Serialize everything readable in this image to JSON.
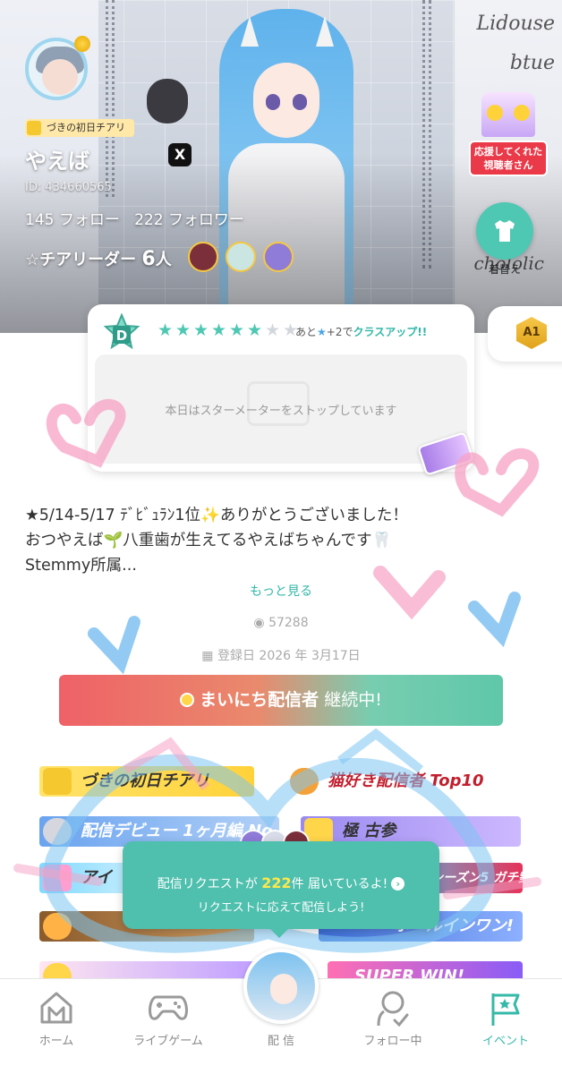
{
  "profile": {
    "cheer_tag": "づきの初日チアリ",
    "username": "やえば",
    "user_id": "ID: 434660565",
    "following_count": "145",
    "following_label": "フォロー",
    "follower_count": "222",
    "follower_label": "フォロワー",
    "cheerleader_label": "☆チアリーダー",
    "cheerleader_count": "6",
    "cheerleader_unit": "人",
    "cheer_more": "•••",
    "x_label": "X",
    "supporters_label": "応援してくれた\n視聴者さん",
    "dress_label": "着替え",
    "deco_text_1": "Lidouse",
    "deco_text_2": "btue",
    "deco_text_3": "chololic"
  },
  "star_meter": {
    "class_letter": "D",
    "stars_filled": 6,
    "stars_total": 8,
    "info_prefix": "あと",
    "info_plus": "+2で",
    "info_action": "クラスアップ!!",
    "message": "本日はスターメーターをストップしています",
    "tab_rank": "A1"
  },
  "bio": {
    "line1": "★5/14-5/17 ﾃﾞﾋﾞｭﾗﾝ1位✨ありがとうございました！",
    "line2": "おつやえば🌱八重歯が生えてるやえばちゃんです🦷",
    "line3": "Stemmy所属...",
    "more_label": "もっと見る",
    "views": "57288",
    "registered": "登録日 2026 年 3月17日"
  },
  "streak": {
    "label_bold": "まいにち配信者",
    "label_rest": " 継続中!"
  },
  "badges": [
    {
      "text": "づきの初日チアリ",
      "color": "#ffd84d"
    },
    {
      "text": "猫好き配信者 Top10",
      "color": "#ffffff"
    },
    {
      "text": "配信デビュー 1ヶ月編 No.1",
      "color": "#7fb2f0"
    },
    {
      "text": "極 古参",
      "color": "#b7a4f5"
    },
    {
      "text": "アイ",
      "color": "#9ee6ff"
    },
    {
      "text": "ットリ! シーズン5 ガチ勢",
      "color": "#5ed0f2"
    },
    {
      "text": "ホールインワン!",
      "color": "#5c86e0"
    },
    {
      "text": "SUPER WIN!",
      "color": "#ff6fb3"
    }
  ],
  "request_popup": {
    "prefix": "配信リクエストが",
    "count": "222",
    "unit": "件",
    "suffix": "届いているよ!",
    "line2": "リクエストに応えて配信しよう!"
  },
  "nav": {
    "home": "ホーム",
    "live_game": "ライブゲーム",
    "stream": "配 信",
    "following": "フォロー中",
    "event": "イベント"
  },
  "colors": {
    "accent": "#35b9a8",
    "star": "#4ec7b3",
    "streak_left": "#ef6167",
    "streak_right": "#5fc7a9",
    "doodle_pink": "#f7a1c4",
    "doodle_blue": "#7ec4f2"
  }
}
